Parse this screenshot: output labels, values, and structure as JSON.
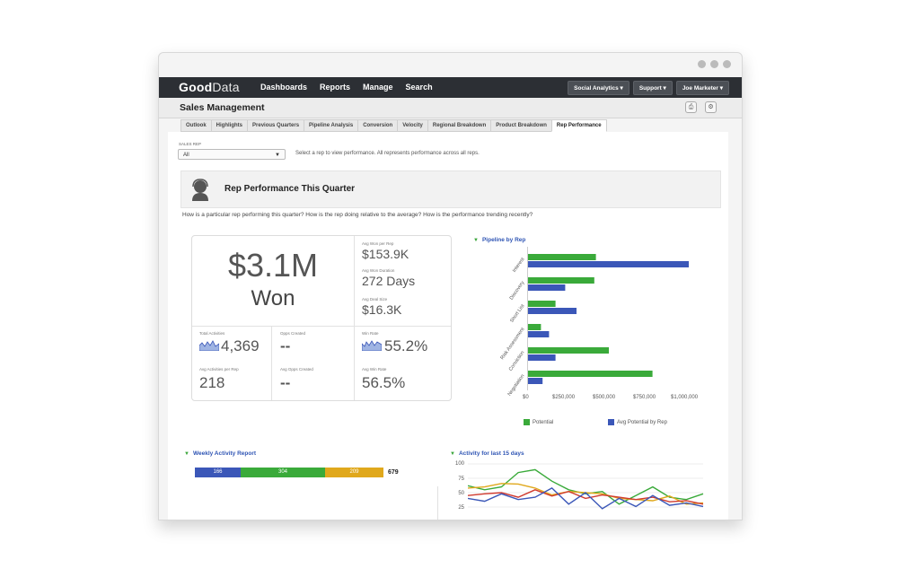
{
  "brand": {
    "name_bold": "Good",
    "name_light": "Data"
  },
  "nav": [
    "Dashboards",
    "Reports",
    "Manage",
    "Search"
  ],
  "top_buttons": [
    "Social Analytics ▾",
    "Support ▾",
    "Joe Marketer ▾"
  ],
  "page_title": "Sales Management",
  "tabs": [
    "Outlook",
    "Highlights",
    "Previous Quarters",
    "Pipeline Analysis",
    "Conversion",
    "Velocity",
    "Regional Breakdown",
    "Product Breakdown",
    "Rep Performance"
  ],
  "active_tab": "Rep Performance",
  "filter": {
    "label": "SALES REP",
    "value": "All",
    "hint": "Select a rep to view performance. All represents performance across all reps."
  },
  "banner_title": "Rep Performance This Quarter",
  "question": "How is a particular rep performing this quarter?  How is the rep doing relative to the average?  How is the performance trending recently?",
  "kpi": {
    "big_value": "$3.1M",
    "big_label": "Won",
    "avg_won_label": "Avg Won per Rep",
    "avg_won_value": "$153.9K",
    "avg_dur_label": "Avg Won Duration",
    "avg_dur_value": "272 Days",
    "avg_deal_label": "Avg Deal Size",
    "avg_deal_value": "$16.3K",
    "total_act_label": "Total Activities",
    "total_act_value": "4,369",
    "opps_label": "Opps Created",
    "opps_value": "--",
    "winrate_label": "Win Rate",
    "winrate_value": "55.2%",
    "avg_act_label": "Avg Activities per Rep",
    "avg_act_value": "218",
    "avg_opps_label": "Avg Opps Created",
    "avg_opps_value": "--",
    "avg_winrate_label": "Avg Win Rate",
    "avg_winrate_value": "56.5%"
  },
  "pipeline": {
    "title": "Pipeline by Rep",
    "legend": [
      "Potential",
      "Avg Potential by Rep"
    ],
    "colors": {
      "potential": "#3aaa3a",
      "avg": "#3b57b8"
    }
  },
  "weekly": {
    "title": "Weekly Activity Report",
    "total": "679",
    "segments": [
      {
        "value": "166",
        "color": "#3b57b8"
      },
      {
        "value": "304",
        "color": "#3aaa3a"
      },
      {
        "value": "209",
        "color": "#e0a81c"
      }
    ]
  },
  "activity": {
    "title": "Activity for last 15 days",
    "yticks": [
      "100",
      "75",
      "50",
      "25"
    ]
  },
  "chart_data": [
    {
      "type": "bar",
      "title": "Pipeline by Rep",
      "orientation": "horizontal",
      "categories": [
        "Interest",
        "Discovery",
        "Short List",
        "Risk Assessment",
        "Conviction",
        "Negotiation"
      ],
      "series": [
        {
          "name": "Potential",
          "values": [
            420000,
            410000,
            170000,
            80000,
            500000,
            770000
          ]
        },
        {
          "name": "Avg Potential by Rep",
          "values": [
            1000000,
            230000,
            300000,
            130000,
            170000,
            90000
          ]
        }
      ],
      "xlim": [
        0,
        1000000
      ],
      "xticks": [
        "$0",
        "$250,000",
        "$500,000",
        "$750,000",
        "$1,000,000"
      ],
      "legend": "bottom"
    },
    {
      "type": "line",
      "title": "Activity for last 15 days",
      "ylim": [
        0,
        100
      ],
      "yticks": [
        25,
        50,
        75,
        100
      ],
      "series": [
        {
          "color": "#3aaa3a",
          "values": [
            62,
            55,
            60,
            85,
            90,
            70,
            55,
            48,
            52,
            30,
            45,
            60,
            42,
            38,
            48
          ]
        },
        {
          "color": "#e0a81c",
          "values": [
            58,
            60,
            66,
            65,
            58,
            46,
            52,
            50,
            48,
            40,
            38,
            36,
            44,
            30,
            32
          ]
        },
        {
          "color": "#d03a2e",
          "values": [
            45,
            48,
            50,
            42,
            55,
            44,
            52,
            40,
            46,
            42,
            38,
            42,
            34,
            36,
            30
          ]
        },
        {
          "color": "#3b57b8",
          "values": [
            40,
            35,
            48,
            38,
            42,
            58,
            30,
            50,
            22,
            40,
            26,
            45,
            28,
            32,
            26
          ]
        }
      ]
    }
  ]
}
